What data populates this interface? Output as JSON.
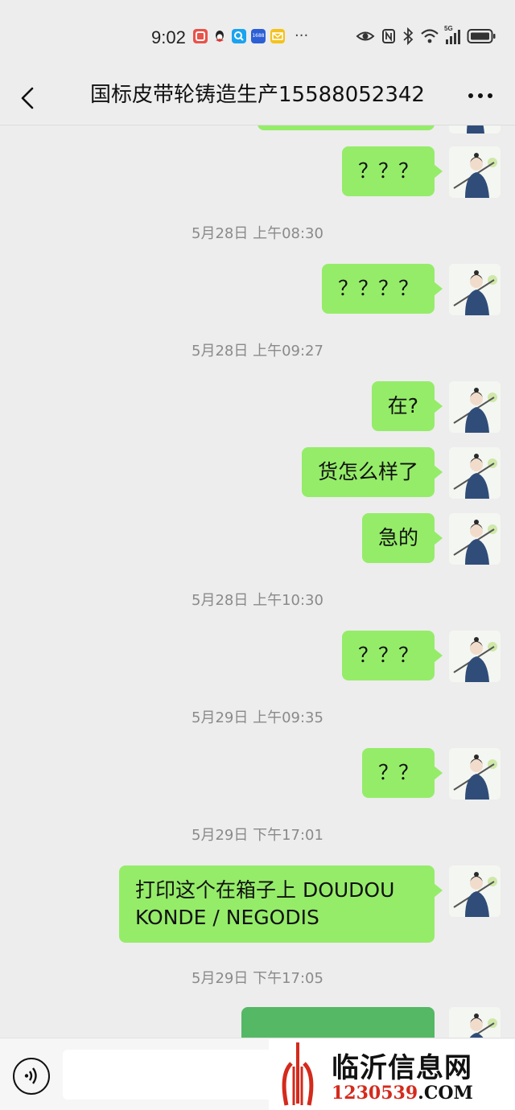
{
  "status_bar": {
    "time": "9:02",
    "app_icons": [
      "notification-icon",
      "qq-icon",
      "search-app-icon",
      "1688-app-icon",
      "mail-icon"
    ],
    "icons_right": [
      "eye-icon",
      "nfc-icon",
      "bluetooth-icon",
      "wifi-icon",
      "5g-signal-icon",
      "battery-icon"
    ],
    "network": "5G",
    "app_badge": "1688"
  },
  "header": {
    "title": "国标皮带轮铸造生产15588052342"
  },
  "messages": [
    {
      "type": "text",
      "text": "？？？"
    },
    {
      "type": "time",
      "text": "5月28日 上午08:30"
    },
    {
      "type": "text",
      "text": "？？？？"
    },
    {
      "type": "time",
      "text": "5月28日 上午09:27"
    },
    {
      "type": "text",
      "text": "在?"
    },
    {
      "type": "text",
      "text": "货怎么样了"
    },
    {
      "type": "text",
      "text": "急的"
    },
    {
      "type": "time",
      "text": "5月28日 上午10:30"
    },
    {
      "type": "text",
      "text": "？？？"
    },
    {
      "type": "time",
      "text": "5月29日 上午09:35"
    },
    {
      "type": "text",
      "text": "？？"
    },
    {
      "type": "time",
      "text": "5月29日 下午17:01"
    },
    {
      "type": "text",
      "text": "打印这个在箱子上 DOUDOU KONDE / NEGODIS"
    },
    {
      "type": "time",
      "text": "5月29日 下午17:05"
    },
    {
      "type": "image"
    }
  ],
  "input_bar": {
    "voice_icon": "voice-icon",
    "placeholder": ""
  },
  "watermark": {
    "name": "临沂信息网",
    "domain_num": "1230539",
    "domain_tld": ".COM"
  },
  "colors": {
    "background": "#ededed",
    "my_bubble": "#95ec69",
    "timestamp": "#8a8a8a",
    "watermark_red": "#d42a1c"
  }
}
